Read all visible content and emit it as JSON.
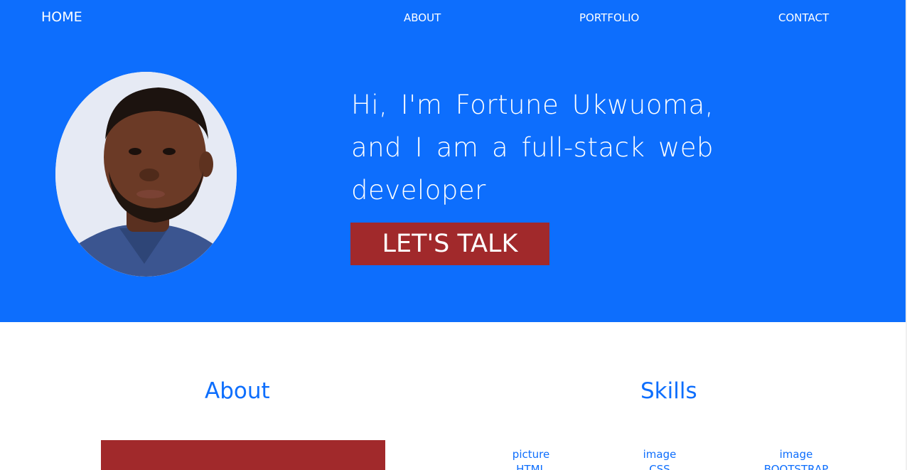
{
  "nav": {
    "home": "HOME",
    "about": "ABOUT",
    "portfolio": "PORTFOLIO",
    "contact": "CONTACT"
  },
  "hero": {
    "headline": "Hi, I'm Fortune Ukwuoma, and I am a full-stack web developer",
    "cta_label": "LET'S TALK"
  },
  "sections": {
    "about_title": "About",
    "skills_title": "Skills"
  },
  "skills": [
    {
      "alt": "picture",
      "name": "HTML"
    },
    {
      "alt": "image",
      "name": "CSS"
    },
    {
      "alt": "image",
      "name": "BOOTSTRAP"
    }
  ],
  "colors": {
    "primary": "#0d6efd",
    "accent": "#a1292b",
    "background": "#ffffff"
  }
}
